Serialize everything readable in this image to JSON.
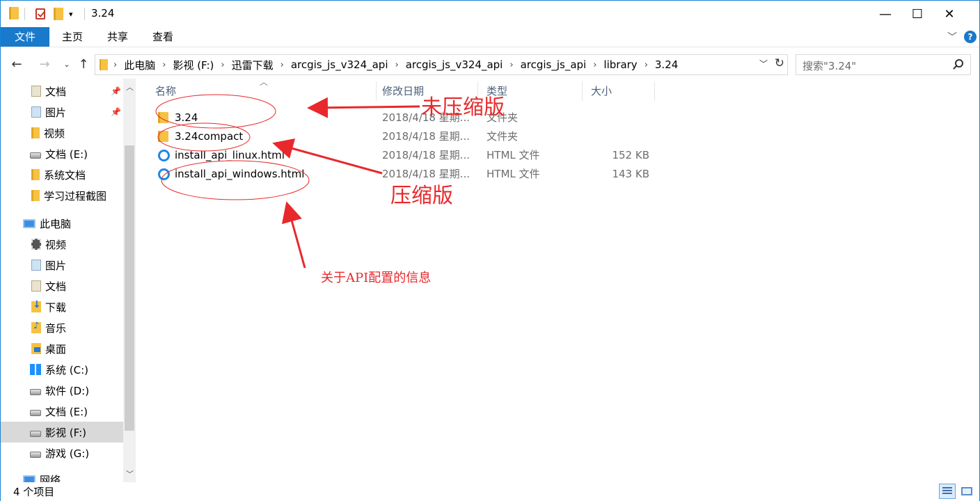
{
  "window": {
    "title": "3.24",
    "controls": [
      "—",
      "☐",
      "✕"
    ]
  },
  "ribbon": {
    "tabs": [
      "文件",
      "主页",
      "共享",
      "查看"
    ]
  },
  "address": {
    "crumbs": [
      "此电脑",
      "影视 (F:)",
      "迅雷下载",
      "arcgis_js_v324_api",
      "arcgis_js_v324_api",
      "arcgis_js_api",
      "library",
      "3.24"
    ],
    "search_placeholder": "搜索\"3.24\""
  },
  "navpane": {
    "items": [
      {
        "label": "文档",
        "icon": "document-library-icon",
        "pinned": true
      },
      {
        "label": "图片",
        "icon": "pictures-library-icon",
        "pinned": true
      },
      {
        "label": "视频",
        "icon": "folder-icon",
        "pinned": false
      },
      {
        "label": "文档 (E:)",
        "icon": "drive-icon",
        "pinned": false
      },
      {
        "label": "系统文档",
        "icon": "folder-icon",
        "pinned": false
      },
      {
        "label": "学习过程截图",
        "icon": "folder-icon",
        "pinned": false
      },
      {
        "label": "此电脑",
        "icon": "computer-icon",
        "pinned": false
      },
      {
        "label": "视频",
        "icon": "videos-library-icon",
        "pinned": false
      },
      {
        "label": "图片",
        "icon": "pictures-library-icon",
        "pinned": false
      },
      {
        "label": "文档",
        "icon": "document-library-icon",
        "pinned": false
      },
      {
        "label": "下载",
        "icon": "downloads-icon",
        "pinned": false
      },
      {
        "label": "音乐",
        "icon": "music-icon",
        "pinned": false
      },
      {
        "label": "桌面",
        "icon": "desktop-icon",
        "pinned": false
      },
      {
        "label": "系统  (C:)",
        "icon": "system-drive-icon",
        "pinned": false
      },
      {
        "label": "软件 (D:)",
        "icon": "drive-icon",
        "pinned": false
      },
      {
        "label": "文档 (E:)",
        "icon": "drive-icon",
        "pinned": false
      },
      {
        "label": "影视 (F:)",
        "icon": "drive-icon",
        "pinned": false,
        "selected": true
      },
      {
        "label": "游戏 (G:)",
        "icon": "drive-icon",
        "pinned": false
      },
      {
        "label": "网络",
        "icon": "network-icon",
        "pinned": false
      }
    ]
  },
  "filelist": {
    "columns": [
      "名称",
      "修改日期",
      "类型",
      "大小"
    ],
    "rows": [
      {
        "name": "3.24",
        "date": "2018/4/18 星期...",
        "type": "文件夹",
        "size": "",
        "icon": "folder-icon"
      },
      {
        "name": "3.24compact",
        "date": "2018/4/18 星期...",
        "type": "文件夹",
        "size": "",
        "icon": "folder-icon"
      },
      {
        "name": "install_api_linux.html",
        "date": "2018/4/18 星期...",
        "type": "HTML 文件",
        "size": "152 KB",
        "icon": "html-file-icon"
      },
      {
        "name": "install_api_windows.html",
        "date": "2018/4/18 星期...",
        "type": "HTML 文件",
        "size": "143 KB",
        "icon": "html-file-icon"
      }
    ]
  },
  "annotations": {
    "uncompressed": "未压缩版",
    "compressed": "压缩版",
    "api_config": "关于API配置的信息",
    "color": "#e8282b"
  },
  "status": {
    "item_count": "4 个项目"
  },
  "colors": {
    "accent": "#1979ca",
    "folder": "#f6c244",
    "selection": "#d9d9d9"
  }
}
